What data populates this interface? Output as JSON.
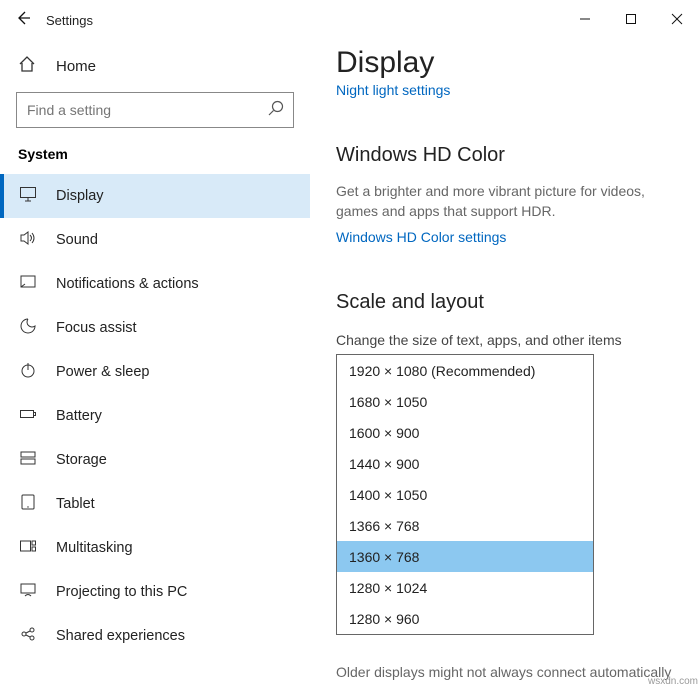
{
  "window": {
    "title": "Settings"
  },
  "sidebar": {
    "home_label": "Home",
    "search_placeholder": "Find a setting",
    "category": "System",
    "items": [
      {
        "label": "Display",
        "icon": "display-icon"
      },
      {
        "label": "Sound",
        "icon": "sound-icon"
      },
      {
        "label": "Notifications & actions",
        "icon": "notifications-icon"
      },
      {
        "label": "Focus assist",
        "icon": "focus-icon"
      },
      {
        "label": "Power & sleep",
        "icon": "power-icon"
      },
      {
        "label": "Battery",
        "icon": "battery-icon"
      },
      {
        "label": "Storage",
        "icon": "storage-icon"
      },
      {
        "label": "Tablet",
        "icon": "tablet-icon"
      },
      {
        "label": "Multitasking",
        "icon": "multitasking-icon"
      },
      {
        "label": "Projecting to this PC",
        "icon": "projecting-icon"
      },
      {
        "label": "Shared experiences",
        "icon": "shared-icon"
      }
    ]
  },
  "content": {
    "heading": "Display",
    "link_top": "Night light settings",
    "hd_heading": "Windows HD Color",
    "hd_desc": "Get a brighter and more vibrant picture for videos, games and apps that support HDR.",
    "hd_link": "Windows HD Color settings",
    "scale_heading": "Scale and layout",
    "scale_label": "Change the size of text, apps, and other items",
    "resolutions": [
      "1920 × 1080 (Recommended)",
      "1680 × 1050",
      "1600 × 900",
      "1440 × 900",
      "1400 × 1050",
      "1366 × 768",
      "1360 × 768",
      "1280 × 1024",
      "1280 × 960"
    ],
    "selected_index": 6,
    "footnote": "Older displays might not always connect automatically"
  },
  "watermark": "wsxdn.com"
}
